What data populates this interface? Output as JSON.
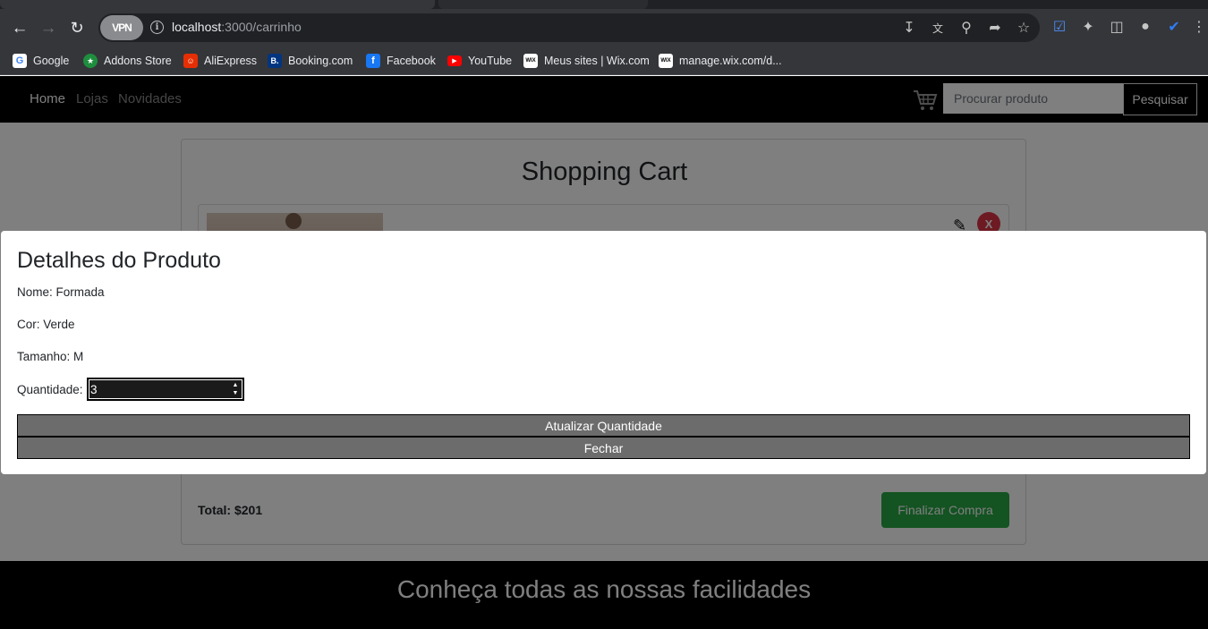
{
  "browser": {
    "url_host": "localhost",
    "url_path": ":3000/carrinho",
    "vpn_label": "VPN",
    "bookmarks": [
      {
        "label": "Google",
        "icon": "google-icon",
        "color": "#ffffff"
      },
      {
        "label": "Addons Store",
        "icon": "addons-store-icon",
        "color": "#1e8e3e"
      },
      {
        "label": "AliExpress",
        "icon": "aliexpress-icon",
        "color": "#e62e04"
      },
      {
        "label": "Booking.com",
        "icon": "booking-icon",
        "color": "#003580"
      },
      {
        "label": "Facebook",
        "icon": "facebook-icon",
        "color": "#1877f2"
      },
      {
        "label": "YouTube",
        "icon": "youtube-icon",
        "color": "#ff0000"
      },
      {
        "label": "Meus sites | Wix.com",
        "icon": "wix-icon",
        "color": "#ffffff"
      },
      {
        "label": "manage.wix.com/d...",
        "icon": "wix-icon",
        "color": "#ffffff"
      }
    ]
  },
  "nav": {
    "links": [
      "Home",
      "Lojas",
      "Novidades"
    ],
    "search_placeholder": "Procurar produto",
    "search_button": "Pesquisar"
  },
  "cart": {
    "title": "Shopping Cart",
    "remove_label": "X",
    "total": "Total: $201",
    "checkout_button": "Finalizar Compra"
  },
  "footer": {
    "title": "Conheça todas as nossas facilidades"
  },
  "modal": {
    "title": "Detalhes do Produto",
    "nome": "Nome: Formada",
    "cor": "Cor: Verde",
    "tamanho": "Tamanho: M",
    "quantidade_label": "Quantidade:",
    "quantidade_value": "3",
    "update_button": "Atualizar Quantidade",
    "close_button": "Fechar"
  },
  "colors": {
    "checkout_green": "#28a745",
    "remove_red": "#dc3545",
    "modal_button_gray": "#6c6c6c"
  }
}
